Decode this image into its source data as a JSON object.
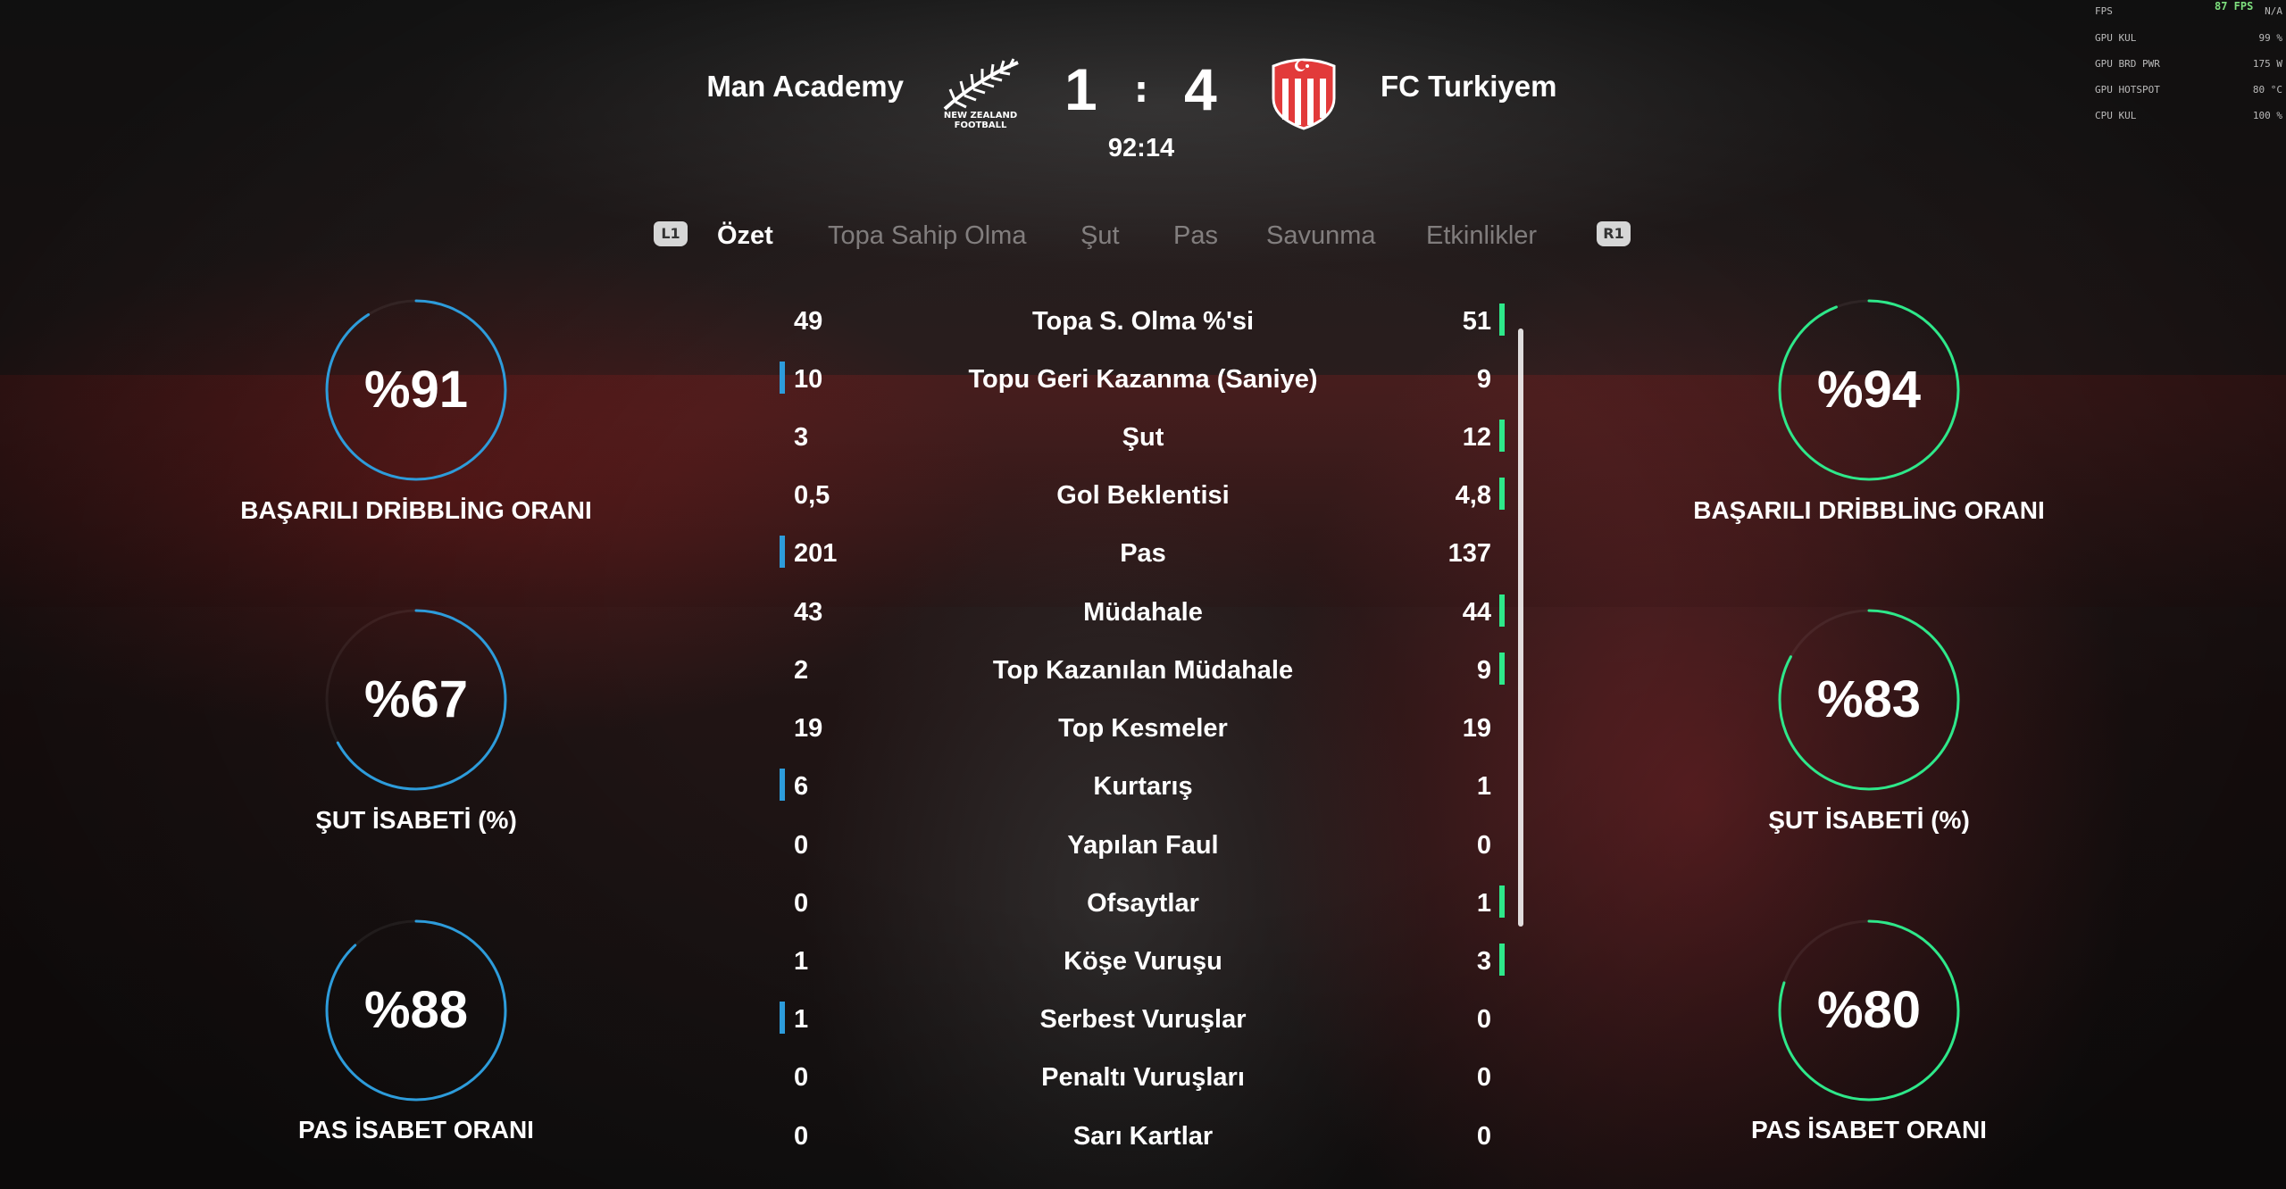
{
  "header": {
    "home_team": "Man Academy",
    "away_team": "FC Turkiyem",
    "home_score": "1",
    "away_score": "4",
    "separator": ":",
    "clock": "92:14",
    "home_crest_text": "NEW ZEALAND FOOTBALL",
    "home_crest_icon": "fern-icon",
    "away_crest_icon": "crescent-star-shield-icon"
  },
  "tabs": {
    "left_shoulder": "L1",
    "right_shoulder": "R1",
    "items": [
      {
        "label": "Özet"
      },
      {
        "label": "Topa Sahip Olma"
      },
      {
        "label": "Şut"
      },
      {
        "label": "Pas"
      },
      {
        "label": "Savunma"
      },
      {
        "label": "Etkinlikler"
      }
    ],
    "active_index": 0
  },
  "colors": {
    "home_accent": "#2d9cdb",
    "away_accent": "#2ee88a"
  },
  "home_rings": [
    {
      "value": "%91",
      "percent": 91,
      "label": "BAŞARILI DRİBBLİNG ORANI"
    },
    {
      "value": "%67",
      "percent": 67,
      "label": "ŞUT İSABETİ (%)"
    },
    {
      "value": "%88",
      "percent": 88,
      "label": "PAS İSABET ORANI"
    }
  ],
  "away_rings": [
    {
      "value": "%94",
      "percent": 94,
      "label": "BAŞARILI DRİBBLİNG ORANI"
    },
    {
      "value": "%83",
      "percent": 83,
      "label": "ŞUT İSABETİ (%)"
    },
    {
      "value": "%80",
      "percent": 80,
      "label": "PAS İSABET ORANI"
    }
  ],
  "stats": [
    {
      "home": "49",
      "label": "Topa S. Olma %'si",
      "away": "51",
      "leader": "away"
    },
    {
      "home": "10",
      "label": "Topu Geri Kazanma (Saniye)",
      "away": "9",
      "leader": "home"
    },
    {
      "home": "3",
      "label": "Şut",
      "away": "12",
      "leader": "away"
    },
    {
      "home": "0,5",
      "label": "Gol Beklentisi",
      "away": "4,8",
      "leader": "away"
    },
    {
      "home": "201",
      "label": "Pas",
      "away": "137",
      "leader": "home"
    },
    {
      "home": "43",
      "label": "Müdahale",
      "away": "44",
      "leader": "away"
    },
    {
      "home": "2",
      "label": "Top Kazanılan Müdahale",
      "away": "9",
      "leader": "away"
    },
    {
      "home": "19",
      "label": "Top Kesmeler",
      "away": "19",
      "leader": "none"
    },
    {
      "home": "6",
      "label": "Kurtarış",
      "away": "1",
      "leader": "home"
    },
    {
      "home": "0",
      "label": "Yapılan Faul",
      "away": "0",
      "leader": "none"
    },
    {
      "home": "0",
      "label": "Ofsaytlar",
      "away": "1",
      "leader": "away"
    },
    {
      "home": "1",
      "label": "Köşe Vuruşu",
      "away": "3",
      "leader": "away"
    },
    {
      "home": "1",
      "label": "Serbest Vuruşlar",
      "away": "0",
      "leader": "home"
    },
    {
      "home": "0",
      "label": "Penaltı Vuruşları",
      "away": "0",
      "leader": "none"
    },
    {
      "home": "0",
      "label": "Sarı Kartlar",
      "away": "0",
      "leader": "none"
    }
  ],
  "overlay": {
    "fps": "87 FPS",
    "rows": [
      {
        "key": "FPS",
        "value": "N/A"
      },
      {
        "key": "GPU KUL",
        "value": "99 %"
      },
      {
        "key": "GPU BRD PWR",
        "value": "175 W"
      },
      {
        "key": "GPU HOTSPOT",
        "value": "80 °C"
      },
      {
        "key": "CPU KUL",
        "value": "100 %"
      }
    ]
  }
}
